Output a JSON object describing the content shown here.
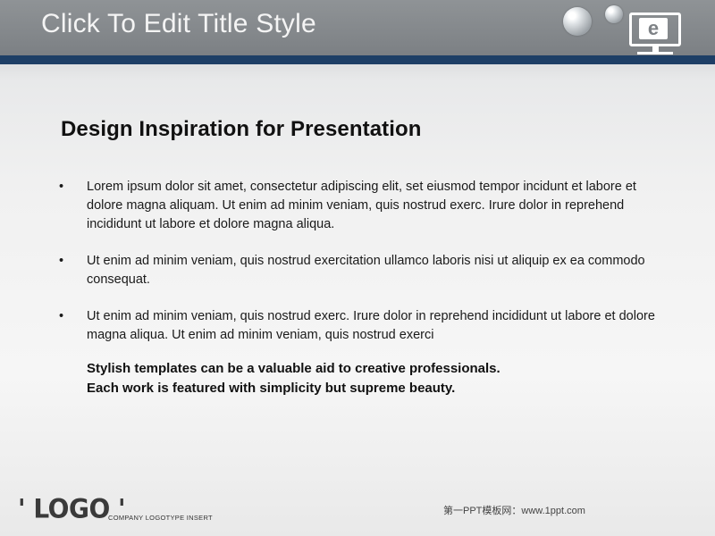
{
  "header": {
    "title": "Click To Edit Title Style",
    "monitor_letter": "e"
  },
  "content": {
    "heading": "Design Inspiration for Presentation",
    "bullet_marker": "•",
    "bullets": [
      "Lorem ipsum dolor sit amet, consectetur adipiscing elit, set eiusmod tempor incidunt et labore et dolore magna aliquam. Ut enim ad minim veniam, quis nostrud exerc. Irure dolor in reprehend incididunt ut labore et dolore magna aliqua.",
      "Ut enim ad minim veniam, quis nostrud exercitation ullamco laboris nisi ut aliquip ex ea commodo consequat.",
      "Ut enim ad minim veniam, quis nostrud exerc. Irure dolor in reprehend incididunt ut labore et dolore magna aliqua. Ut enim ad minim veniam, quis nostrud exerci"
    ],
    "emphasis_lines": [
      "Stylish templates can be a valuable aid to creative professionals.",
      "Each work is featured with simplicity but supreme beauty."
    ]
  },
  "footer": {
    "logo": "' LOGO '",
    "logo_tagline": "COMPANY LOGOTYPE INSERT",
    "site": "第一PPT模板网：www.1ppt.com"
  },
  "colors": {
    "header_gray": "#858a8e",
    "header_line_blue": "#1e3f66",
    "text_dark": "#111111"
  }
}
